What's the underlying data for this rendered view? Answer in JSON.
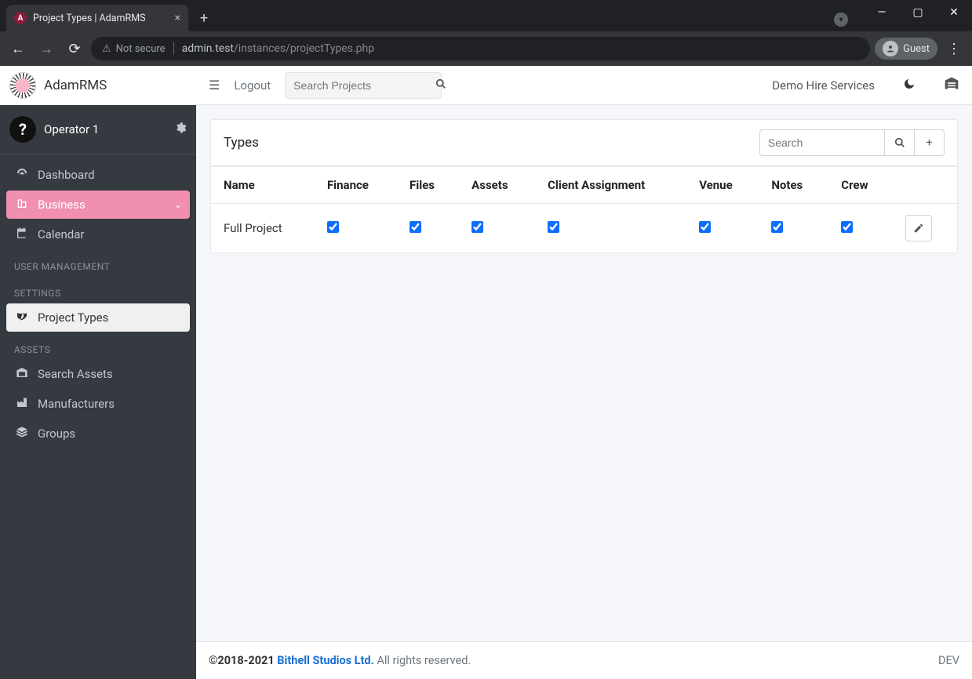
{
  "browser": {
    "tab_title": "Project Types | AdamRMS",
    "not_secure": "Not secure",
    "url_host": "admin.test",
    "url_path": "/instances/projectTypes.php",
    "guest": "Guest"
  },
  "brand": "AdamRMS",
  "user": {
    "name": "Operator 1"
  },
  "topbar": {
    "logout": "Logout",
    "search_placeholder": "Search Projects",
    "instance": "Demo Hire Services"
  },
  "sidebar": {
    "items": [
      {
        "label": "Dashboard"
      },
      {
        "label": "Business"
      },
      {
        "label": "Calendar"
      }
    ],
    "headers": {
      "user_mgmt": "USER MANAGEMENT",
      "settings": "SETTINGS",
      "assets": "ASSETS"
    },
    "settings_items": [
      {
        "label": "Project Types"
      }
    ],
    "assets_items": [
      {
        "label": "Search Assets"
      },
      {
        "label": "Manufacturers"
      },
      {
        "label": "Groups"
      }
    ]
  },
  "card": {
    "title": "Types",
    "search_placeholder": "Search"
  },
  "table": {
    "cols": [
      "Name",
      "Finance",
      "Files",
      "Assets",
      "Client Assignment",
      "Venue",
      "Notes",
      "Crew"
    ],
    "rows": [
      {
        "name": "Full Project",
        "finance": true,
        "files": true,
        "assets": true,
        "client_assignment": true,
        "venue": true,
        "notes": true,
        "crew": true
      }
    ]
  },
  "footer": {
    "copyright_prefix": "©2018-2021 ",
    "company": "Bithell Studios Ltd.",
    "copyright_suffix": " All rights reserved.",
    "env": "DEV"
  }
}
